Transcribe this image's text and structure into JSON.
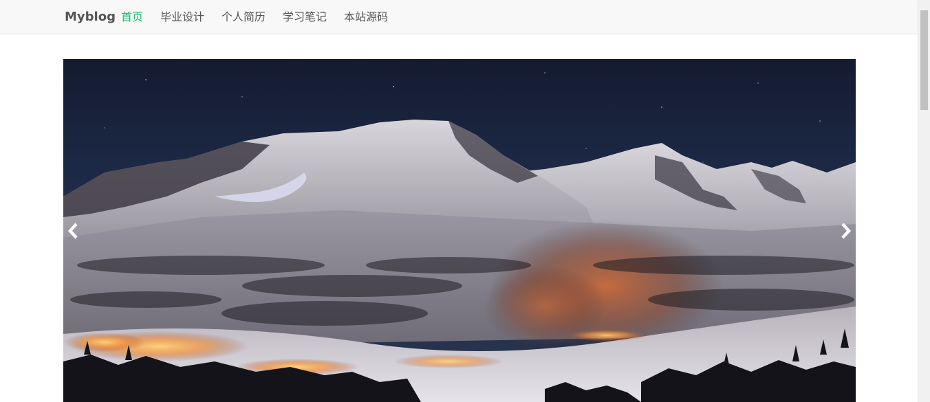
{
  "navbar": {
    "brand": "Myblog",
    "items": [
      {
        "label": "首页",
        "active": true
      },
      {
        "label": "毕业设计",
        "active": false
      },
      {
        "label": "个人简历",
        "active": false
      },
      {
        "label": "学习笔记",
        "active": false
      },
      {
        "label": "本站源码",
        "active": false
      }
    ],
    "active_color": "#1abc6d"
  },
  "carousel": {
    "slide_content": "night-mountain-landscape",
    "prev_icon": "chevron-left-icon",
    "next_icon": "chevron-right-icon"
  }
}
